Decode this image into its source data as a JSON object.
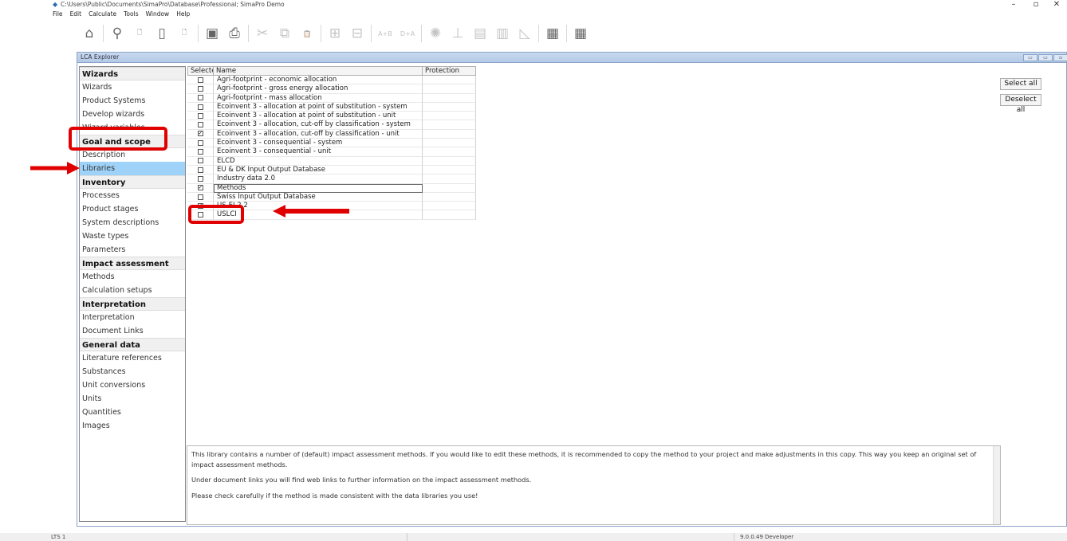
{
  "window": {
    "title": "C:\\Users\\Public\\Documents\\SimaPro\\Database\\Professional; SimaPro Demo",
    "minimize": "–",
    "maximize": "▫",
    "close": "✕"
  },
  "menu": [
    "File",
    "Edit",
    "Calculate",
    "Tools",
    "Window",
    "Help"
  ],
  "toolbar": [
    {
      "icon": "home-icon",
      "glyph": "⌂",
      "enabled": true
    },
    {
      "icon": "search-icon",
      "glyph": "⚲",
      "enabled": true
    },
    {
      "icon": "new-document-icon",
      "glyph": "🗋",
      "enabled": true
    },
    {
      "icon": "open-icon",
      "glyph": "▯",
      "enabled": true
    },
    {
      "icon": "document-clock-icon",
      "glyph": "🗋",
      "enabled": true
    },
    {
      "icon": "save-icon",
      "glyph": "▣",
      "enabled": true
    },
    {
      "icon": "print-icon",
      "glyph": "⎙",
      "enabled": true
    },
    {
      "icon": "cut-icon",
      "glyph": "✂",
      "enabled": false
    },
    {
      "icon": "copy-icon",
      "glyph": "⧉",
      "enabled": false
    },
    {
      "icon": "paste-icon",
      "glyph": "📋",
      "enabled": false
    },
    {
      "icon": "expand-icon",
      "glyph": "⊞",
      "enabled": false
    },
    {
      "icon": "collapse-icon",
      "glyph": "⊟",
      "enabled": false
    },
    {
      "icon": "compare-ab-icon",
      "glyph": "A+B",
      "enabled": false
    },
    {
      "icon": "compare-da-icon",
      "glyph": "D+A",
      "enabled": false
    },
    {
      "icon": "network-icon",
      "glyph": "✺",
      "enabled": false
    },
    {
      "icon": "tree-icon",
      "glyph": "⊥",
      "enabled": false
    },
    {
      "icon": "process-icon",
      "glyph": "▤",
      "enabled": false
    },
    {
      "icon": "bar-chart-icon",
      "glyph": "▥",
      "enabled": false
    },
    {
      "icon": "line-chart-icon",
      "glyph": "◺",
      "enabled": false
    },
    {
      "icon": "report-icon",
      "glyph": "▦",
      "enabled": true
    },
    {
      "icon": "calculator-icon",
      "glyph": "▦",
      "enabled": true
    }
  ],
  "explorer": {
    "title": "LCA Explorer",
    "groups": [
      {
        "header": "Wizards",
        "items": [
          "Wizards",
          "Product Systems",
          "Develop wizards",
          "Wizard variables"
        ]
      },
      {
        "header": "Goal and scope",
        "items": [
          "Description",
          "Libraries"
        ]
      },
      {
        "header": "Inventory",
        "items": [
          "Processes",
          "Product stages",
          "System descriptions",
          "Waste types",
          "Parameters"
        ]
      },
      {
        "header": "Impact assessment",
        "items": [
          "Methods",
          "Calculation setups"
        ]
      },
      {
        "header": "Interpretation",
        "items": [
          "Interpretation",
          "Document Links"
        ]
      },
      {
        "header": "General data",
        "items": [
          "Literature references",
          "Substances",
          "Unit conversions",
          "Units",
          "Quantities",
          "Images"
        ]
      }
    ],
    "selected": "Libraries"
  },
  "table": {
    "headers": {
      "select": "Selecte",
      "name": "Name",
      "protection": "Protection"
    },
    "rows": [
      {
        "name": "Agri-footprint - economic allocation",
        "checked": false
      },
      {
        "name": "Agri-footprint - gross energy allocation",
        "checked": false
      },
      {
        "name": "Agri-footprint - mass allocation",
        "checked": false
      },
      {
        "name": "Ecoinvent 3 - allocation at point of substitution - system",
        "checked": false
      },
      {
        "name": "Ecoinvent 3 - allocation at point of substitution - unit",
        "checked": false
      },
      {
        "name": "Ecoinvent 3 - allocation, cut-off by classification - system",
        "checked": false
      },
      {
        "name": "Ecoinvent 3 - allocation, cut-off by classification - unit",
        "checked": true
      },
      {
        "name": "Ecoinvent 3 - consequential - system",
        "checked": false
      },
      {
        "name": "Ecoinvent 3 - consequential - unit",
        "checked": false
      },
      {
        "name": "ELCD",
        "checked": false
      },
      {
        "name": "EU & DK Input Output Database",
        "checked": false
      },
      {
        "name": "Industry data 2.0",
        "checked": false
      },
      {
        "name": "Methods",
        "checked": true
      },
      {
        "name": "Swiss Input Output Database",
        "checked": false
      },
      {
        "name": "US-EI 2.2",
        "checked": true
      },
      {
        "name": "USLCI",
        "checked": false
      }
    ]
  },
  "buttons": {
    "select_all": "Select all",
    "deselect_all": "Deselect all"
  },
  "description": [
    "This library contains a number of (default) impact assessment methods. If you would like to edit these methods, it is recommended to copy the method to your project and make adjustments in this copy. This way you keep an original set of impact assessment methods.",
    "Under document links you will find web links to further information on the impact assessment methods.",
    "Please check carefully if the method is made consistent with the data libraries you use!"
  ],
  "status": {
    "left": "LTS 1",
    "version": "9.0.0.49 Developer"
  },
  "colors": {
    "highlight": "#e00000",
    "selection": "#9fd2f8"
  }
}
